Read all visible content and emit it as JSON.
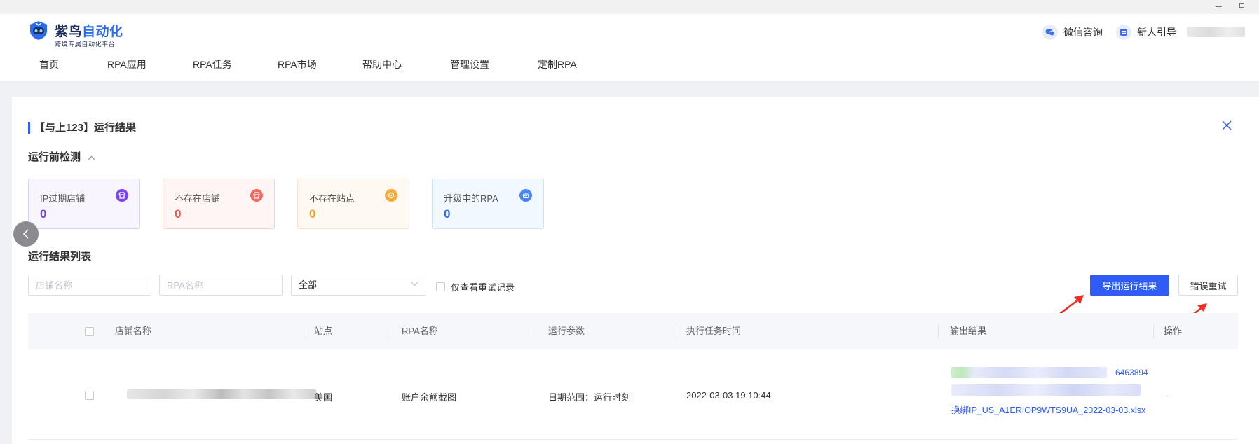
{
  "window": {
    "minimize_icon": "minimize-icon",
    "maximize_icon": "maximize-icon"
  },
  "header": {
    "logo": {
      "name_dark": "紫鸟",
      "name_blue": "自动化",
      "slogan": "跨境专属自动化平台"
    },
    "wechat_label": "微信咨询",
    "guide_label": "新人引导",
    "nav": [
      "首页",
      "RPA应用",
      "RPA任务",
      "RPA市场",
      "帮助中心",
      "管理设置",
      "定制RPA"
    ]
  },
  "page": {
    "title": "【与上123】运行结果",
    "precheck": {
      "heading": "运行前检测",
      "cards": [
        {
          "label": "IP过期店铺",
          "value": "0",
          "color": "#7140e4",
          "icon": "store-icon"
        },
        {
          "label": "不存在店铺",
          "value": "0",
          "color": "#f0574a",
          "icon": "shop-missing-icon"
        },
        {
          "label": "不存在站点",
          "value": "0",
          "color": "#f4a128",
          "icon": "site-missing-icon"
        },
        {
          "label": "升级中的RPA",
          "value": "0",
          "color": "#2f6ef2",
          "icon": "robot-upgrade-icon"
        }
      ]
    },
    "results": {
      "heading": "运行结果列表",
      "filters": {
        "shop_placeholder": "店铺名称",
        "rpa_placeholder": "RPA名称",
        "status_value": "全部",
        "retry_only_label": "仅查看重试记录"
      },
      "export_label": "导出运行结果",
      "retry_label": "错误重试",
      "columns": [
        "店铺名称",
        "站点",
        "RPA名称",
        "运行参数",
        "执行任务时间",
        "输出结果",
        "操作"
      ],
      "rows": [
        {
          "site": "美国",
          "rpa": "账户余额截图",
          "params": "日期范围：运行时刻",
          "time": "2022-03-03 19:10:44",
          "output_fragment": "6463894",
          "output_link": "换绑IP_US_A1ERIOP9WTS9UA_2022-03-03.xlsx",
          "action": "-"
        }
      ]
    }
  }
}
